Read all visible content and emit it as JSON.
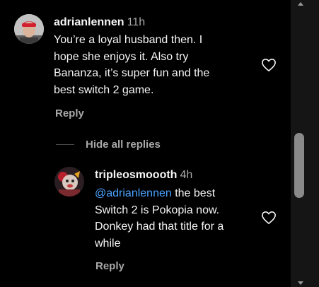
{
  "comment": {
    "username": "adrianlennen",
    "time": "11h",
    "text_lines": [
      "You’re a loyal husband then. I",
      "hope she enjoys it. Also try",
      "Bananza, it’s super fun and the",
      "best switch 2 game."
    ],
    "reply_label": "Reply",
    "like_icon": "heart-outline"
  },
  "replies_toggle": {
    "label": "Hide all replies"
  },
  "reply": {
    "username": "tripleosmoooth",
    "time": "4h",
    "mention": "@adrianlennen",
    "text_lines": [
      " the best",
      "Switch 2 is Pokopia now.",
      "Donkey had that title for a",
      "while"
    ],
    "reply_label": "Reply",
    "like_icon": "heart-outline"
  },
  "colors": {
    "background": "#000000",
    "text": "#f5f5f5",
    "muted": "#a8a8a8",
    "mention": "#4aa3ff",
    "scrollbar_track": "#151515",
    "scrollbar_thumb": "#8a8a8a"
  }
}
